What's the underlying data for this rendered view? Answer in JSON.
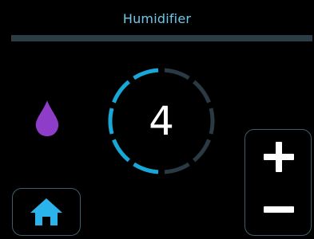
{
  "header": {
    "title": "Humidifier"
  },
  "status": {
    "mode_icon": "water-drop-icon",
    "drop_color": "#8E3DC8"
  },
  "dial": {
    "level": "4",
    "segments_total": 10,
    "segments_active": 5,
    "active_color": "#18A8D8",
    "inactive_color": "#2A3A42"
  },
  "controls": {
    "increase_icon": "plus-icon",
    "decrease_icon": "minus-icon",
    "home_icon": "home-icon",
    "accent": "#2BB3EC"
  }
}
